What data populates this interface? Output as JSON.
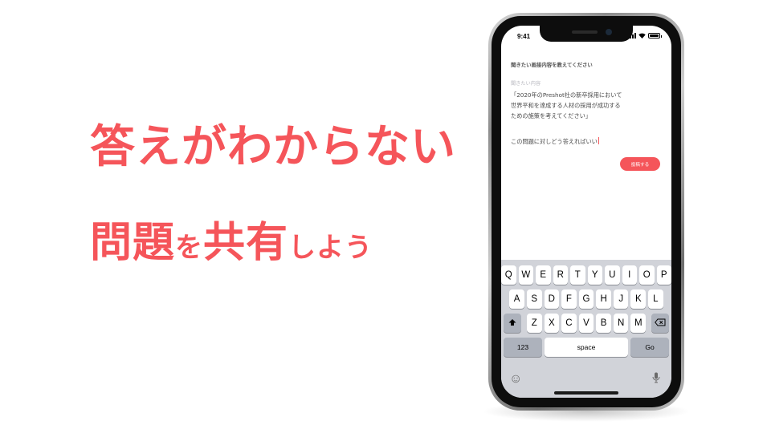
{
  "headline": {
    "line1": "答えがわからない",
    "line2_big_a": "問題",
    "line2_small_a": "を",
    "line2_big_b": "共有",
    "line2_small_b": "しよう"
  },
  "colors": {
    "accent": "#f5555a"
  },
  "phone": {
    "status_time": "9:41",
    "battery_level": 1.0,
    "prompt_title": "聞きたい画接内容を教えてください",
    "field_label": "聞きたい内容",
    "field_body": "「2020年のPreshot社の新卒採用において\n世界平和を達成する人材の採用が成功する\nための施策を考えてください」",
    "question_text": "この問題に対しどう答えればいい",
    "post_button": "投稿する"
  },
  "keyboard": {
    "row1": [
      "Q",
      "W",
      "E",
      "R",
      "T",
      "Y",
      "U",
      "I",
      "O",
      "P"
    ],
    "row2": [
      "A",
      "S",
      "D",
      "F",
      "G",
      "H",
      "J",
      "K",
      "L"
    ],
    "row3": [
      "Z",
      "X",
      "C",
      "V",
      "B",
      "N",
      "M"
    ],
    "shift_icon": "shift-icon",
    "backspace_icon": "backspace-icon",
    "mode_key": "123",
    "space_key": "space",
    "go_key": "Go",
    "emoji_icon": "emoji-icon",
    "mic_icon": "microphone-icon"
  }
}
